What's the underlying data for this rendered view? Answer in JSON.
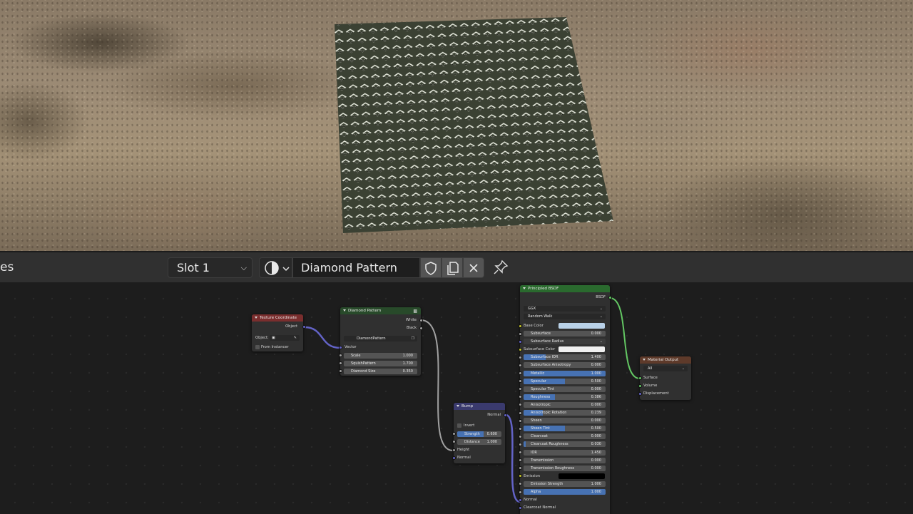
{
  "header": {
    "left_fragment": "es",
    "slot": "Slot 1",
    "material_name": "Diamond Pattern",
    "icons": [
      "material-sphere-icon",
      "chevron-down-icon",
      "fake-user-shield-icon",
      "duplicate-icon",
      "close-icon",
      "pin-icon"
    ]
  },
  "nodes": {
    "texture_coordinate": {
      "title": "Texture Coordinate",
      "output": "Object",
      "object_label": "Object:",
      "from_instancer": "From Instancer",
      "color": "#7a2e2e"
    },
    "diamond_pattern": {
      "title": "Diamond Pattern",
      "outputs": [
        "White",
        "Black"
      ],
      "datablock": "DiamondPattern",
      "vector": "Vector",
      "fields": [
        {
          "label": "Scale",
          "value": "1.000"
        },
        {
          "label": "SquishPattern",
          "value": "1.700"
        },
        {
          "label": "Diamond Size",
          "value": "0.350"
        }
      ],
      "color": "#284a2a"
    },
    "bump": {
      "title": "Bump",
      "output": "Normal",
      "invert": "Invert",
      "fields": [
        {
          "label": "Strength",
          "value": "0.600",
          "fill": 0.6
        },
        {
          "label": "Distance",
          "value": "1.000",
          "fill": 0
        }
      ],
      "inputs": [
        "Height",
        "Normal"
      ],
      "color": "#3a3a6e"
    },
    "principled": {
      "title": "Principled BSDF",
      "output": "BSDF",
      "distribution": "GGX",
      "subsurface_method": "Random Walk",
      "base_color_label": "Base Color",
      "base_color": "#b9d1e8",
      "subsurface_color_label": "Subsurface Color",
      "subsurface_color": "#f0f0f0",
      "subsurface_radius": "Subsurface Radius",
      "fields": [
        {
          "label": "Subsurface",
          "value": "0.000",
          "fill": 0
        },
        {
          "label": "Subsurface IOR",
          "value": "1.400",
          "fill": 0.27
        },
        {
          "label": "Subsurface Anisotropy",
          "value": "0.000",
          "fill": 0
        },
        {
          "label": "Metallic",
          "value": "1.000",
          "fill": 1
        },
        {
          "label": "Specular",
          "value": "0.500",
          "fill": 0.5
        },
        {
          "label": "Specular Tint",
          "value": "0.000",
          "fill": 0
        },
        {
          "label": "Roughness",
          "value": "0.386",
          "fill": 0.386
        },
        {
          "label": "Anisotropic",
          "value": "0.000",
          "fill": 0
        },
        {
          "label": "Anisotropic Rotation",
          "value": "0.239",
          "fill": 0.239
        },
        {
          "label": "Sheen",
          "value": "0.000",
          "fill": 0
        },
        {
          "label": "Sheen Tint",
          "value": "0.500",
          "fill": 0.5
        },
        {
          "label": "Clearcoat",
          "value": "0.000",
          "fill": 0
        },
        {
          "label": "Clearcoat Roughness",
          "value": "0.030",
          "fill": 0.03
        },
        {
          "label": "IOR",
          "value": "1.450",
          "fill": 0
        },
        {
          "label": "Transmission",
          "value": "0.000",
          "fill": 0
        },
        {
          "label": "Transmission Roughness",
          "value": "0.000",
          "fill": 0
        }
      ],
      "emission": "Emission",
      "emission_fields": [
        {
          "label": "Emission Strength",
          "value": "1.000",
          "fill": 0
        },
        {
          "label": "Alpha",
          "value": "1.000",
          "fill": 1
        }
      ],
      "normal": "Normal",
      "clearcoat_normal": "Clearcoat Normal",
      "color": "#2a6a2e"
    },
    "material_output": {
      "title": "Material Output",
      "target": "All",
      "inputs": [
        "Surface",
        "Volume",
        "Displacement"
      ],
      "color": "#5e3a2a"
    }
  }
}
